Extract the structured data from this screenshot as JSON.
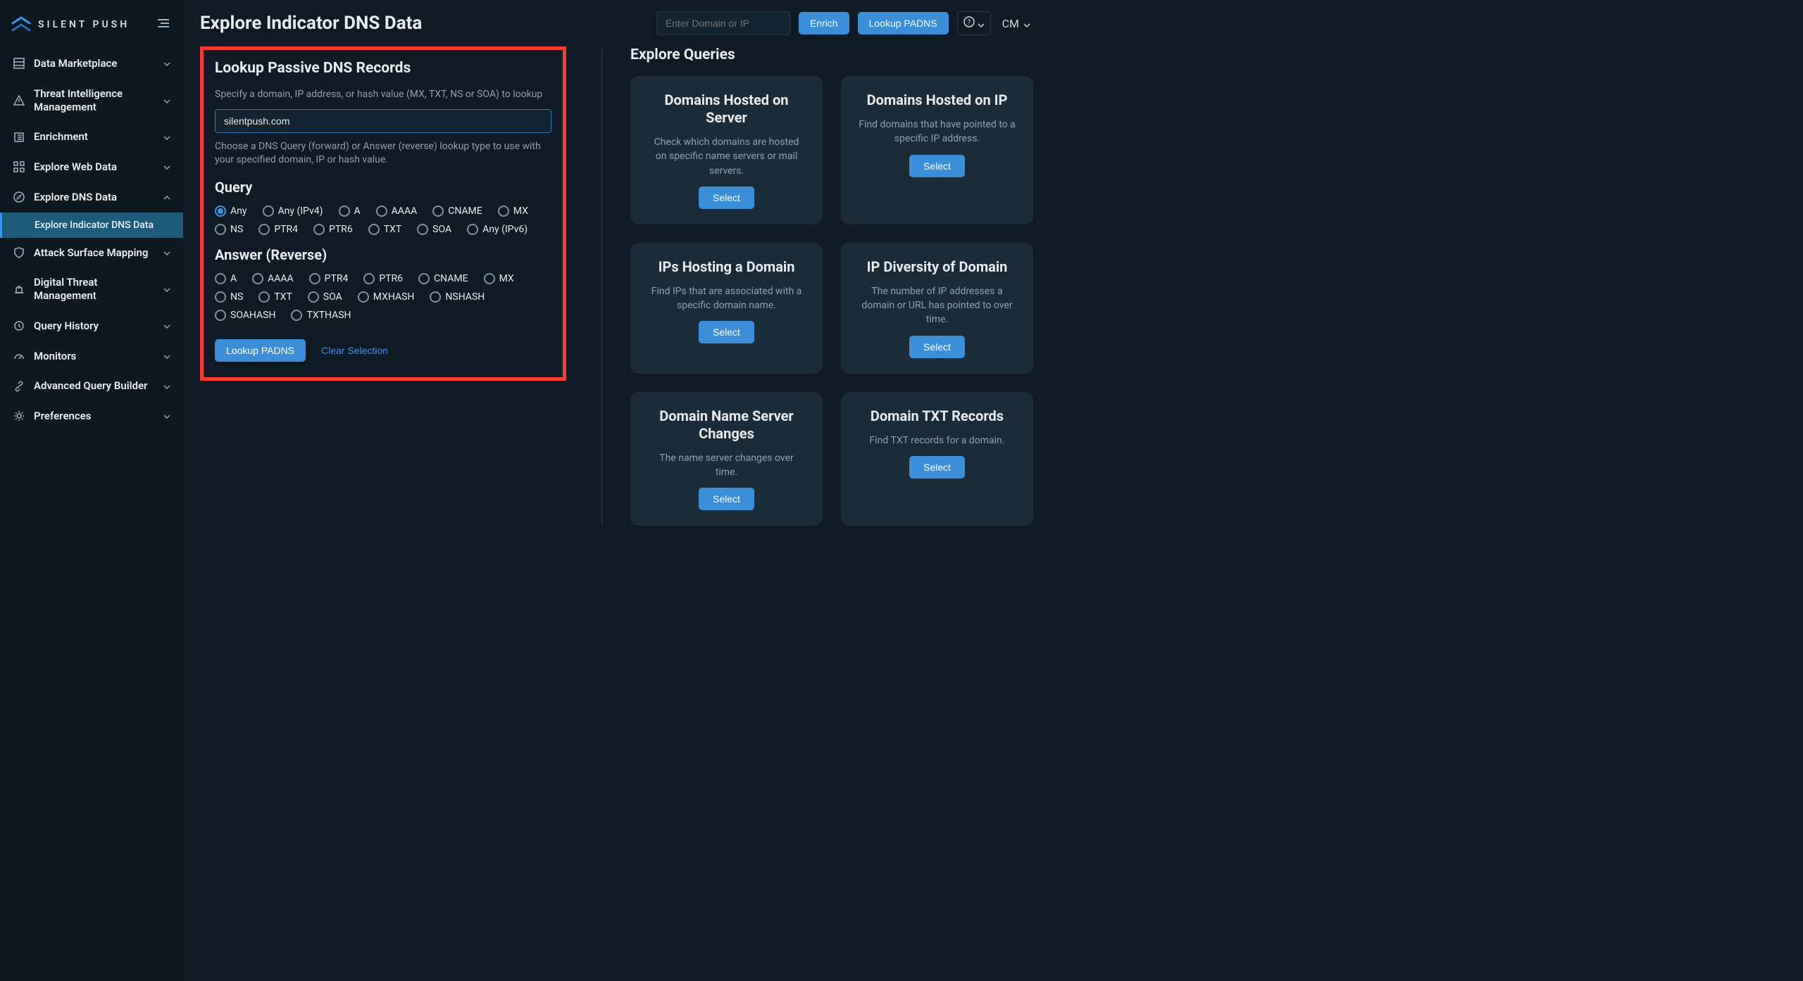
{
  "brand": {
    "name": "SILENT PUSH"
  },
  "sidebar": {
    "items": [
      {
        "label": "Data Marketplace",
        "icon": "marketplace-icon"
      },
      {
        "label": "Threat Intelligence Management",
        "icon": "warning-icon"
      },
      {
        "label": "Enrichment",
        "icon": "enrichment-icon"
      },
      {
        "label": "Explore Web Data",
        "icon": "grid-icon"
      },
      {
        "label": "Explore DNS Data",
        "icon": "compass-icon",
        "expanded": true,
        "sub": [
          {
            "label": "Explore Indicator DNS Data"
          }
        ]
      },
      {
        "label": "Attack Surface Mapping",
        "icon": "shield-icon"
      },
      {
        "label": "Digital Threat Management",
        "icon": "alarm-icon"
      },
      {
        "label": "Query History",
        "icon": "history-icon"
      },
      {
        "label": "Monitors",
        "icon": "gauge-icon"
      },
      {
        "label": "Advanced Query Builder",
        "icon": "link-icon"
      },
      {
        "label": "Preferences",
        "icon": "gear-icon"
      }
    ]
  },
  "header": {
    "title": "Explore Indicator DNS Data",
    "search_placeholder": "Enter Domain or IP",
    "enrich_label": "Enrich",
    "lookup_label": "Lookup PADNS",
    "user_initials": "CM"
  },
  "lookup": {
    "title": "Lookup Passive DNS Records",
    "help1": "Specify a domain, IP address, or hash value (MX, TXT, NS or SOA) to lookup",
    "input_value": "silentpush.com",
    "help2": "Choose a DNS Query (forward) or Answer (reverse) lookup type to use with your specified domain, IP or hash value.",
    "query_title": "Query",
    "query_options": [
      "Any",
      "Any (IPv4)",
      "A",
      "AAAA",
      "CNAME",
      "MX",
      "NS",
      "PTR4",
      "PTR6",
      "TXT",
      "SOA",
      "Any (IPv6)"
    ],
    "query_selected": "Any",
    "answer_title": "Answer (Reverse)",
    "answer_options": [
      "A",
      "AAAA",
      "PTR4",
      "PTR6",
      "CNAME",
      "MX",
      "NS",
      "TXT",
      "SOA",
      "MXHASH",
      "NSHASH",
      "SOAHASH",
      "TXTHASH"
    ],
    "submit_label": "Lookup PADNS",
    "clear_label": "Clear Selection"
  },
  "queries": {
    "title": "Explore Queries",
    "select_label": "Select",
    "cards": [
      {
        "title": "Domains Hosted on Server",
        "desc": "Check which domains are hosted on specific name servers or mail servers."
      },
      {
        "title": "Domains Hosted on IP",
        "desc": "Find domains that have pointed to a specific IP address."
      },
      {
        "title": "IPs Hosting a Domain",
        "desc": "Find IPs that are associated with a specific domain name."
      },
      {
        "title": "IP Diversity of Domain",
        "desc": "The number of IP addresses a domain or URL has pointed to over time."
      },
      {
        "title": "Domain Name Server Changes",
        "desc": "The name server changes over time."
      },
      {
        "title": "Domain TXT Records",
        "desc": "Find TXT records for a domain."
      }
    ]
  }
}
